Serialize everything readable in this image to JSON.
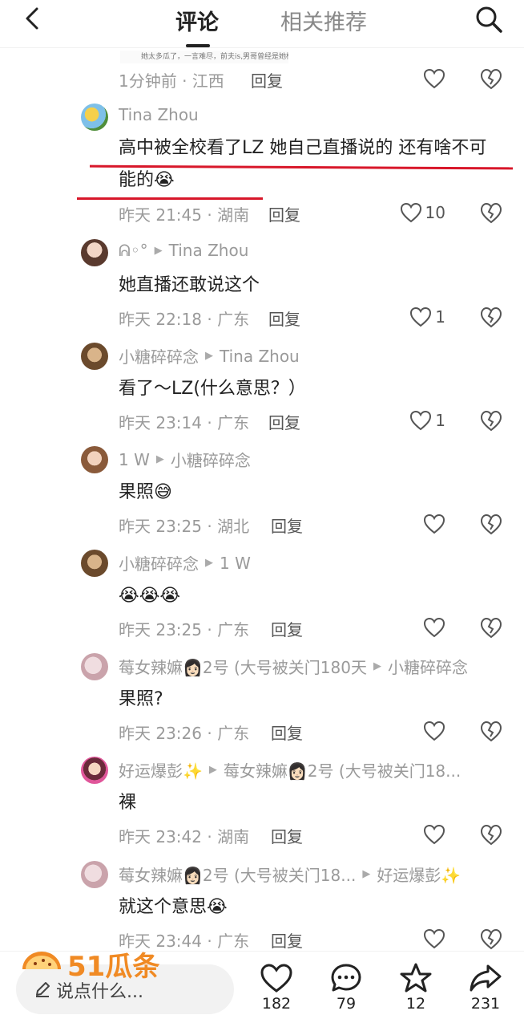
{
  "header": {
    "tabs": [
      "评论",
      "相关推荐"
    ]
  },
  "top_comment": {
    "snippet_text": "她太多瓜了，一言难尽，前夫is,男哥曾经是她榜一",
    "time": "1分钟前 · 江西",
    "reply": "回复"
  },
  "comments": [
    {
      "author": "Tina Zhou",
      "reply_to": "",
      "text": "高中被全校看了LZ 她自己直播说的 还有啥不可能的",
      "emoji": "😭",
      "time": "昨天 21:45 · 湖南",
      "reply": "回复",
      "likes": "10"
    },
    {
      "author": "ᕱ◦°",
      "reply_to": "Tina Zhou",
      "text": "她直播还敢说这个",
      "emoji": "",
      "time": "昨天 22:18 · 广东",
      "reply": "回复",
      "likes": "1"
    },
    {
      "author": "小糖碎碎念",
      "reply_to": "Tina Zhou",
      "text": "看了～LZ(什么意思？）",
      "emoji": "",
      "time": "昨天 23:14 · 广东",
      "reply": "回复",
      "likes": "1"
    },
    {
      "author": "1 W",
      "reply_to": "小糖碎碎念",
      "text": "果照",
      "emoji": "😅",
      "time": "昨天 23:25 · 湖北",
      "reply": "回复",
      "likes": ""
    },
    {
      "author": "小糖碎碎念",
      "reply_to": "1 W",
      "text": "",
      "emoji": "😭😭😭",
      "time": "昨天 23:25 · 广东",
      "reply": "回复",
      "likes": ""
    },
    {
      "author": "莓女辣嫲👩🏻2号 (大号被关门180天",
      "reply_to": "小糖碎碎念",
      "text": "果照?",
      "emoji": "",
      "time": "昨天 23:26 · 广东",
      "reply": "回复",
      "likes": ""
    },
    {
      "author": "好运爆彭✨",
      "reply_to": "莓女辣嫲👩🏻2号 (大号被关门18...",
      "text": "裸",
      "emoji": "",
      "time": "昨天 23:42 · 湖南",
      "reply": "回复",
      "likes": ""
    },
    {
      "author": "莓女辣嫲👩🏻2号 (大号被关门18...",
      "reply_to": "好运爆彭✨",
      "text": "就这个意思",
      "emoji": "😭",
      "time": "昨天 23:44 · 广东",
      "reply": "回复",
      "likes": ""
    }
  ],
  "bottom": {
    "placeholder": "说点什么...",
    "likes": "182",
    "comments": "79",
    "favorites": "12",
    "shares": "231"
  },
  "watermark": {
    "text": "51瓜条"
  },
  "colors": {
    "accent_red": "#d8172a",
    "watermark_orange": "#f08a24"
  },
  "icons": [
    "back-arrow-icon",
    "search-icon",
    "heart-icon",
    "broken-heart-icon",
    "comment-bubble-icon",
    "star-icon",
    "share-icon",
    "pencil-icon"
  ]
}
